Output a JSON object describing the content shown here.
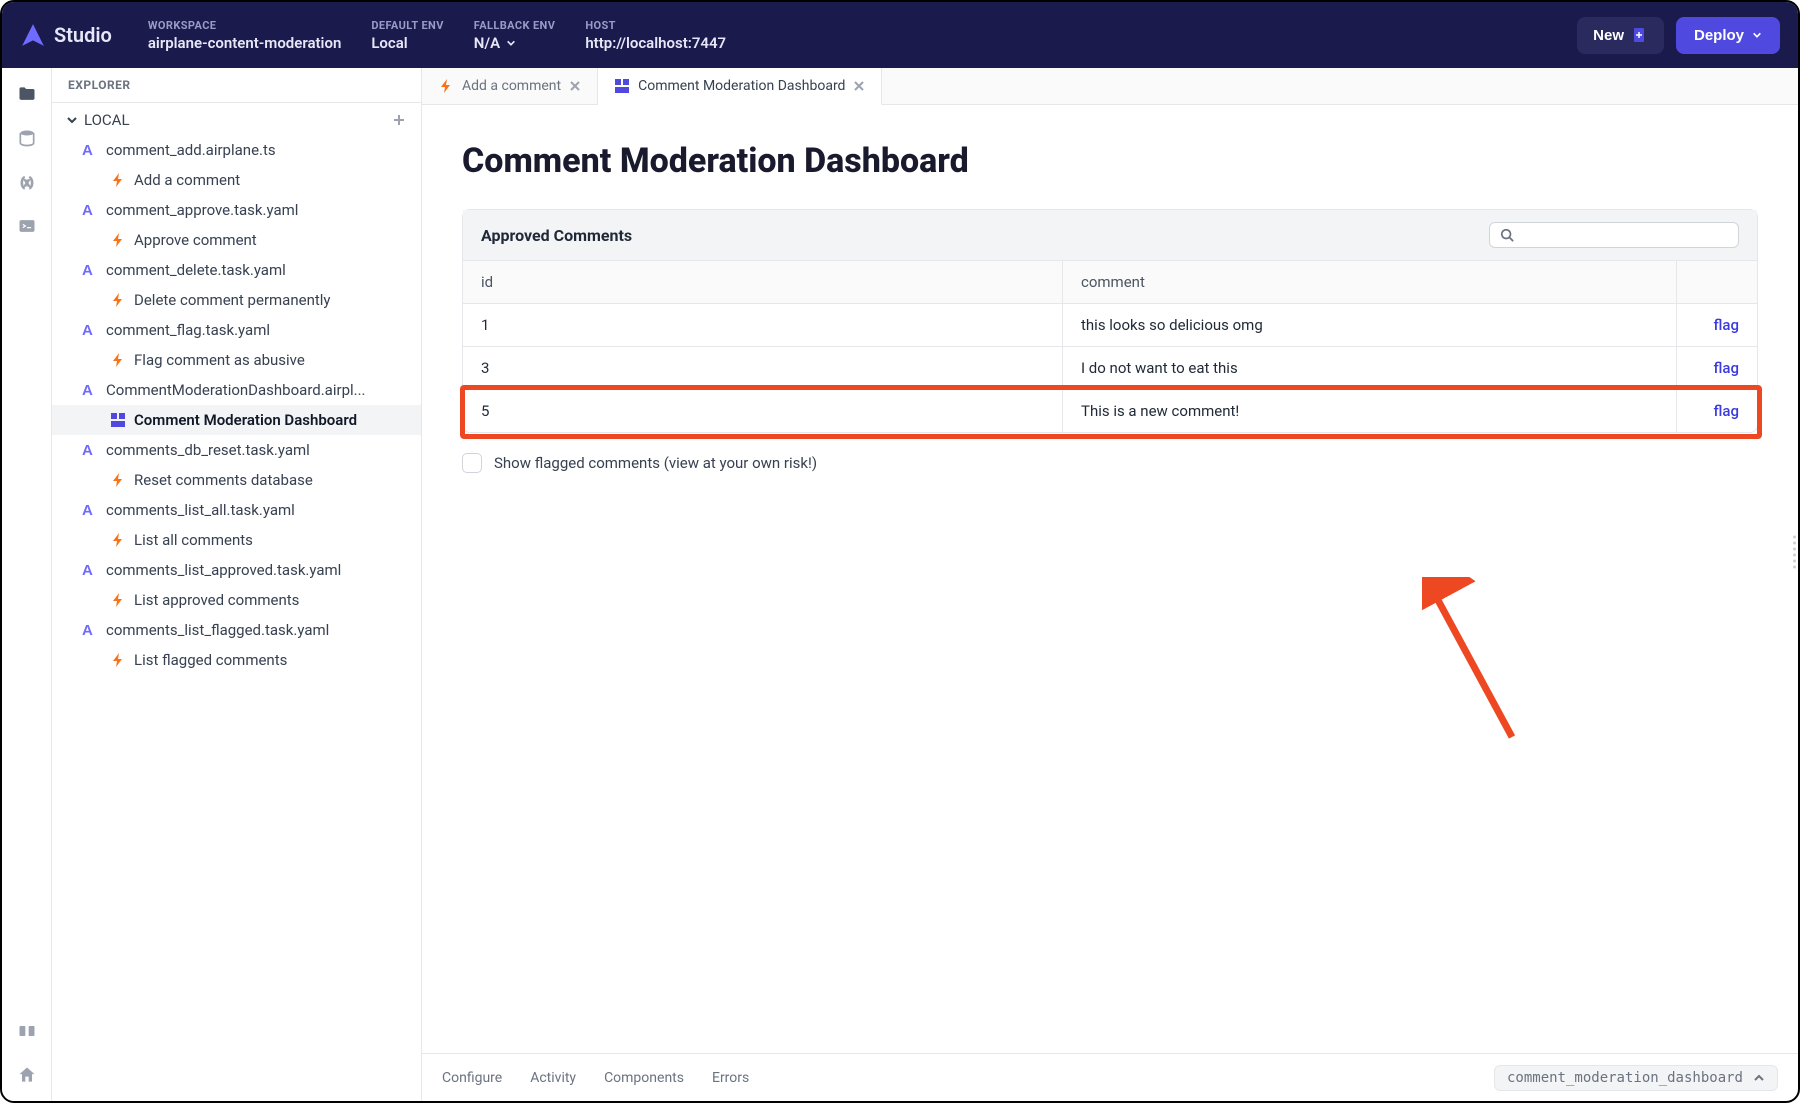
{
  "topbar": {
    "logo_text": "Studio",
    "workspace_label": "WORKSPACE",
    "workspace_value": "airplane-content-moderation",
    "default_env_label": "DEFAULT ENV",
    "default_env_value": "Local",
    "fallback_env_label": "FALLBACK ENV",
    "fallback_env_value": "N/A",
    "host_label": "HOST",
    "host_value": "http://localhost:7447",
    "new_label": "New",
    "deploy_label": "Deploy"
  },
  "explorer": {
    "header": "EXPLORER",
    "group_label": "LOCAL",
    "files": [
      {
        "name": "comment_add.airplane.ts",
        "children": [
          {
            "kind": "task",
            "label": "Add a comment"
          }
        ]
      },
      {
        "name": "comment_approve.task.yaml",
        "children": [
          {
            "kind": "task",
            "label": "Approve comment"
          }
        ]
      },
      {
        "name": "comment_delete.task.yaml",
        "children": [
          {
            "kind": "task",
            "label": "Delete comment permanently"
          }
        ]
      },
      {
        "name": "comment_flag.task.yaml",
        "children": [
          {
            "kind": "task",
            "label": "Flag comment as abusive"
          }
        ]
      },
      {
        "name": "CommentModerationDashboard.airpl...",
        "children": [
          {
            "kind": "view",
            "label": "Comment Moderation Dashboard",
            "selected": true
          }
        ]
      },
      {
        "name": "comments_db_reset.task.yaml",
        "children": [
          {
            "kind": "task",
            "label": "Reset comments database"
          }
        ]
      },
      {
        "name": "comments_list_all.task.yaml",
        "children": [
          {
            "kind": "task",
            "label": "List all comments"
          }
        ]
      },
      {
        "name": "comments_list_approved.task.yaml",
        "children": [
          {
            "kind": "task",
            "label": "List approved comments"
          }
        ]
      },
      {
        "name": "comments_list_flagged.task.yaml",
        "children": [
          {
            "kind": "task",
            "label": "List flagged comments"
          }
        ]
      }
    ]
  },
  "tabs": [
    {
      "kind": "task",
      "label": "Add a comment",
      "active": false
    },
    {
      "kind": "view",
      "label": "Comment Moderation Dashboard",
      "active": true
    }
  ],
  "page": {
    "title": "Comment Moderation Dashboard",
    "table_title": "Approved Comments",
    "columns": {
      "id": "id",
      "comment": "comment"
    },
    "rows": [
      {
        "id": "1",
        "comment": "this looks so delicious omg",
        "action": "flag"
      },
      {
        "id": "3",
        "comment": "I do not want to eat this",
        "action": "flag"
      },
      {
        "id": "5",
        "comment": "This is a new comment!",
        "action": "flag",
        "highlighted": true
      }
    ],
    "checkbox_label": "Show flagged comments (view at your own risk!)"
  },
  "bottom": {
    "items": [
      "Configure",
      "Activity",
      "Components",
      "Errors"
    ],
    "slug": "comment_moderation_dashboard"
  }
}
